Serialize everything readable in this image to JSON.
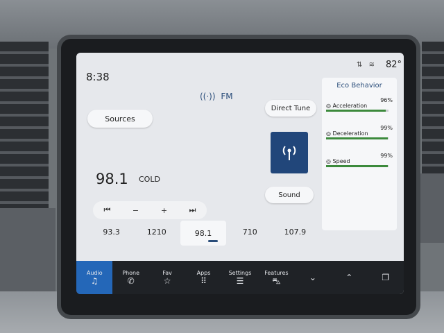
{
  "status": {
    "time": "8:38",
    "temperature": "82°"
  },
  "radio": {
    "band": "FM",
    "sources_label": "Sources",
    "direct_tune_label": "Direct Tune",
    "sound_label": "Sound",
    "frequency": "98.1",
    "station_name": "COLD",
    "controls": {
      "seek_back": "⏮",
      "minus": "−",
      "plus": "+",
      "seek_forward": "⏭"
    },
    "presets": [
      "93.3",
      "1210",
      "98.1",
      "710",
      "107.9"
    ],
    "active_preset": 2
  },
  "eco": {
    "title": "Eco Behavior",
    "metrics": [
      {
        "label": "Acceleration",
        "percent": "96%",
        "level": 0.96
      },
      {
        "label": "Deceleration",
        "percent": "99%",
        "level": 0.99
      },
      {
        "label": "Speed",
        "percent": "99%",
        "level": 0.99
      }
    ]
  },
  "nav": [
    {
      "label": "Audio",
      "icon": "music-note-icon",
      "active": true
    },
    {
      "label": "Phone",
      "icon": "phone-icon",
      "active": false
    },
    {
      "label": "Fav",
      "icon": "star-icon",
      "active": false
    },
    {
      "label": "Apps",
      "icon": "apps-grid-icon",
      "active": false
    },
    {
      "label": "Settings",
      "icon": "sliders-icon",
      "active": false
    },
    {
      "label": "Features",
      "icon": "car-icon",
      "active": false
    },
    {
      "label": "",
      "icon": "chevron-down-icon",
      "active": false
    },
    {
      "label": "",
      "icon": "chevron-up-icon",
      "active": false
    },
    {
      "label": "",
      "icon": "windows-icon",
      "active": false
    }
  ]
}
